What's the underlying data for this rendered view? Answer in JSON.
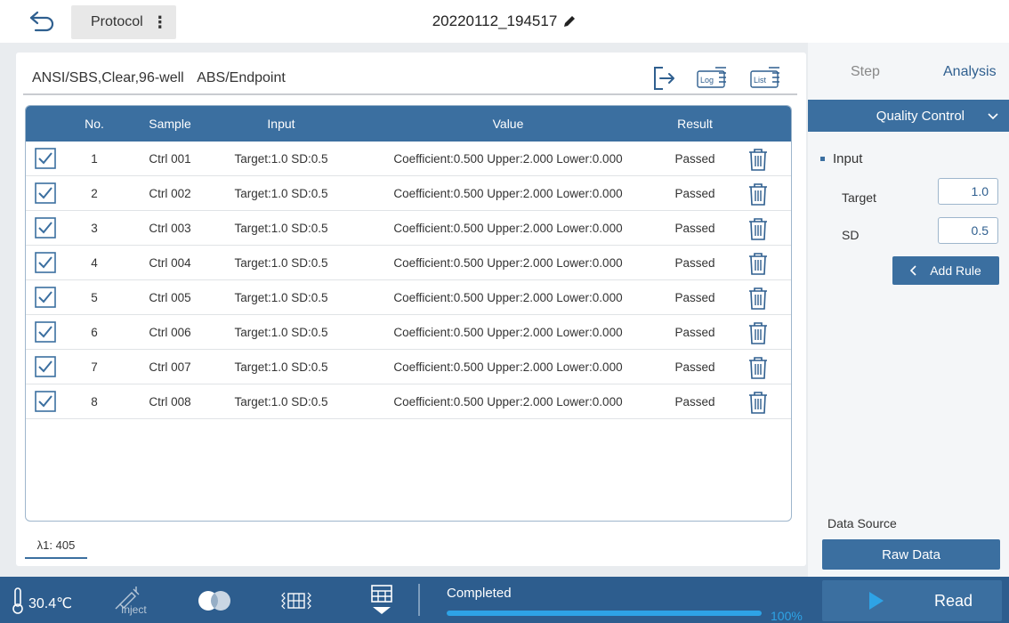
{
  "header": {
    "back_icon": "back-arrow-icon",
    "protocol_label": "Protocol",
    "menu_glyph": "⋮",
    "file_name": "20220112_194517",
    "edit_icon": "pencil-icon"
  },
  "main": {
    "plate_info": "ANSI/SBS,Clear,96-well",
    "mode_info": "ABS/Endpoint",
    "log_label": "Log",
    "list_label": "List",
    "columns": {
      "no": "No.",
      "sample": "Sample",
      "input": "Input",
      "value": "Value",
      "result": "Result"
    },
    "rows": [
      {
        "no": "1",
        "sample": "Ctrl 001",
        "input": "Target:1.0 SD:0.5",
        "value": "Coefficient:0.500 Upper:2.000 Lower:0.000",
        "result": "Passed",
        "checked": true
      },
      {
        "no": "2",
        "sample": "Ctrl 002",
        "input": "Target:1.0 SD:0.5",
        "value": "Coefficient:0.500 Upper:2.000 Lower:0.000",
        "result": "Passed",
        "checked": true
      },
      {
        "no": "3",
        "sample": "Ctrl 003",
        "input": "Target:1.0 SD:0.5",
        "value": "Coefficient:0.500 Upper:2.000 Lower:0.000",
        "result": "Passed",
        "checked": true
      },
      {
        "no": "4",
        "sample": "Ctrl 004",
        "input": "Target:1.0 SD:0.5",
        "value": "Coefficient:0.500 Upper:2.000 Lower:0.000",
        "result": "Passed",
        "checked": true
      },
      {
        "no": "5",
        "sample": "Ctrl 005",
        "input": "Target:1.0 SD:0.5",
        "value": "Coefficient:0.500 Upper:2.000 Lower:0.000",
        "result": "Passed",
        "checked": true
      },
      {
        "no": "6",
        "sample": "Ctrl 006",
        "input": "Target:1.0 SD:0.5",
        "value": "Coefficient:0.500 Upper:2.000 Lower:0.000",
        "result": "Passed",
        "checked": true
      },
      {
        "no": "7",
        "sample": "Ctrl 007",
        "input": "Target:1.0 SD:0.5",
        "value": "Coefficient:0.500 Upper:2.000 Lower:0.000",
        "result": "Passed",
        "checked": true
      },
      {
        "no": "8",
        "sample": "Ctrl 008",
        "input": "Target:1.0 SD:0.5",
        "value": "Coefficient:0.500 Upper:2.000 Lower:0.000",
        "result": "Passed",
        "checked": true
      }
    ],
    "wavelength_tab": "λ1: 405"
  },
  "right": {
    "tab_step": "Step",
    "tab_analysis": "Analysis",
    "active_tab": "Analysis",
    "section_select": "Quality Control",
    "input_heading": "Input",
    "target_label": "Target",
    "target_value": "1.0",
    "sd_label": "SD",
    "sd_value": "0.5",
    "add_rule_label": "Add Rule",
    "data_source_label": "Data Source",
    "data_source_button": "Raw Data"
  },
  "bottom": {
    "temperature": "30.4℃",
    "inject_label": "Inject",
    "status": "Completed",
    "progress_percent": 100,
    "progress_label": "100%",
    "read_label": "Read"
  },
  "colors": {
    "primary": "#3b6fa0",
    "bottom_bar": "#2d5d8e",
    "progress": "#2ea3e6",
    "background": "#e9ecef"
  }
}
